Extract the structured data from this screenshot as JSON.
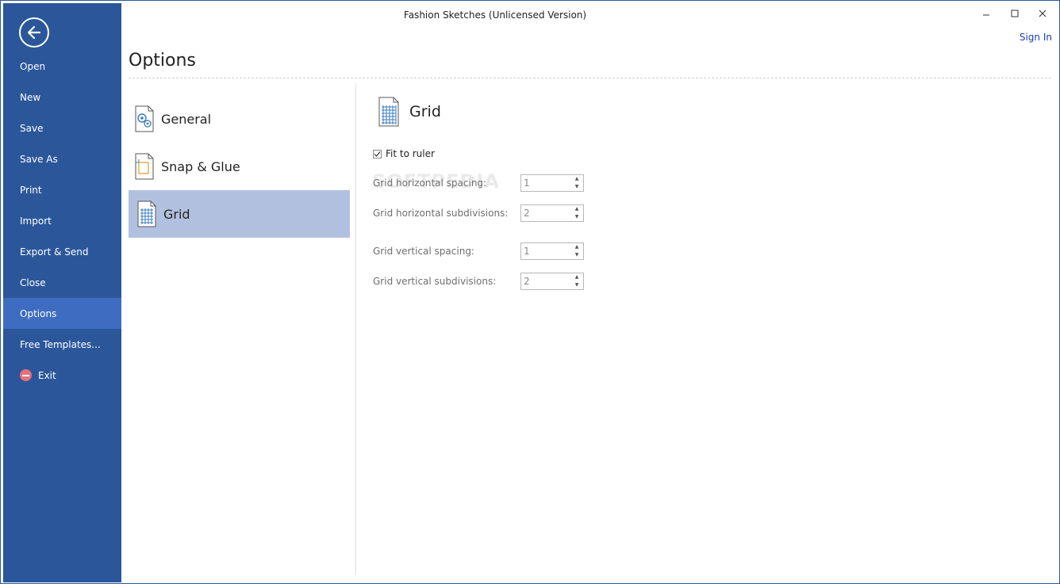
{
  "window": {
    "title": "Fashion Sketches (Unlicensed Version)",
    "sign_in": "Sign In"
  },
  "sidebar": {
    "items": [
      {
        "label": "Open"
      },
      {
        "label": "New"
      },
      {
        "label": "Save"
      },
      {
        "label": "Save As"
      },
      {
        "label": "Print"
      },
      {
        "label": "Import"
      },
      {
        "label": "Export & Send"
      },
      {
        "label": "Close"
      },
      {
        "label": "Options",
        "active": true
      },
      {
        "label": "Free Templates..."
      },
      {
        "label": "Exit"
      }
    ]
  },
  "options": {
    "title": "Options",
    "categories": [
      {
        "label": "General"
      },
      {
        "label": "Snap & Glue"
      },
      {
        "label": "Grid",
        "active": true
      }
    ]
  },
  "grid": {
    "title": "Grid",
    "fit_to_ruler_label": "Fit to ruler",
    "fit_to_ruler_checked": true,
    "fields": [
      {
        "label": "Grid horizontal spacing:",
        "value": "1"
      },
      {
        "label": "Grid horizontal subdivisions:",
        "value": "2"
      },
      {
        "label": "Grid vertical spacing:",
        "value": "1"
      },
      {
        "label": "Grid vertical subdivisions:",
        "value": "2"
      }
    ]
  },
  "watermark": "SOFTPEDIA",
  "colors": {
    "sidebar": "#2b579a",
    "sidebar_active": "#3e6cc0",
    "category_active": "#b2c0e0",
    "link": "#1a3fb0"
  }
}
